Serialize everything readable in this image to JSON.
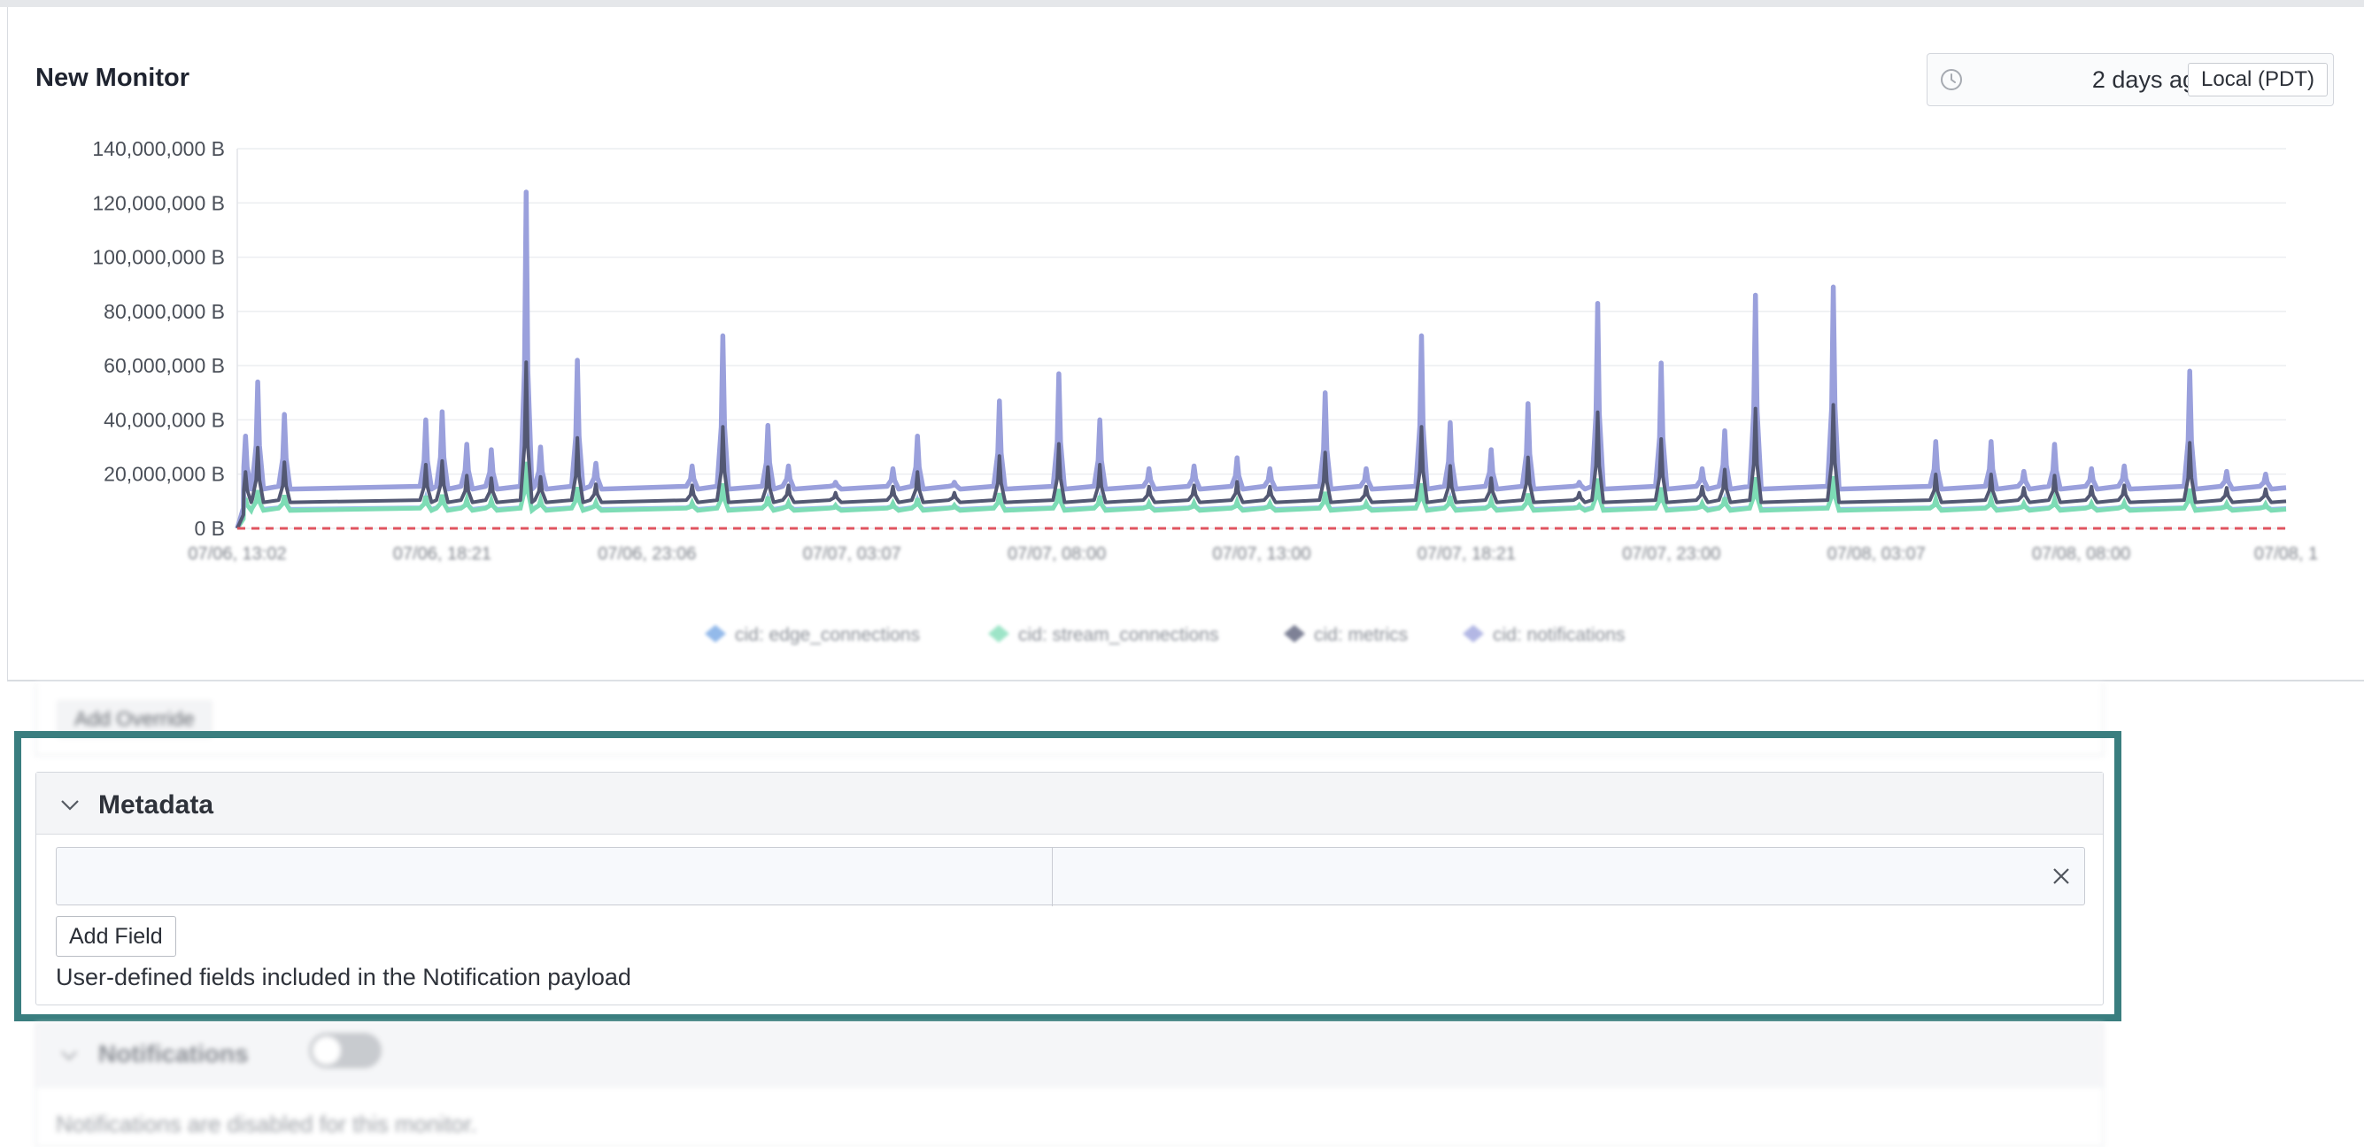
{
  "monitor": {
    "title": "New Monitor",
    "time_range": "2 days ago",
    "timezone": "Local (PDT)"
  },
  "chart_data": {
    "type": "line",
    "yticks": [
      "140,000,000 B",
      "120,000,000 B",
      "100,000,000 B",
      "80,000,000 B",
      "60,000,000 B",
      "40,000,000 B",
      "20,000,000 B",
      "0 B"
    ],
    "ylim": [
      0,
      140000000
    ],
    "xlim": [
      0,
      100
    ],
    "xticks": [
      "07/06, 13:02",
      "07/06, 18:21",
      "07/06, 23:06",
      "07/07, 03:07",
      "07/07, 08:00",
      "07/07, 13:00",
      "07/07, 18:21",
      "07/07, 23:00",
      "07/08, 03:07",
      "07/08, 08:00",
      "07/08, 1"
    ],
    "legend": [
      "cid: edge_connections",
      "cid: stream_connections",
      "cid: metrics",
      "cid: notifications"
    ],
    "legend_position": "bottom",
    "grid": true,
    "threshold": 0,
    "colors": {
      "edge_connections": "#6fa3e3",
      "stream_connections": "#7ddcb5",
      "metrics": "#535873",
      "notifications": "#9aa0dc",
      "threshold": "#e05560"
    },
    "baselines": {
      "edge_connections": 7500000,
      "stream_connections": 7000000,
      "metrics": 10000000,
      "notifications": 15000000
    },
    "series_notifications_spikes": [
      [
        0.4,
        34000000
      ],
      [
        1.0,
        54000000
      ],
      [
        2.3,
        42000000
      ],
      [
        9.2,
        40000000
      ],
      [
        10.0,
        43000000
      ],
      [
        11.2,
        31000000
      ],
      [
        12.4,
        29000000
      ],
      [
        14.1,
        124000000
      ],
      [
        14.8,
        30000000
      ],
      [
        16.6,
        62000000
      ],
      [
        17.5,
        24000000
      ],
      [
        22.2,
        23000000
      ],
      [
        23.7,
        71000000
      ],
      [
        25.9,
        38000000
      ],
      [
        26.9,
        23000000
      ],
      [
        29.2,
        17000000
      ],
      [
        32.0,
        22000000
      ],
      [
        33.2,
        34000000
      ],
      [
        35.0,
        17000000
      ],
      [
        37.2,
        47000000
      ],
      [
        40.1,
        57000000
      ],
      [
        42.1,
        40000000
      ],
      [
        44.5,
        22000000
      ],
      [
        46.7,
        23000000
      ],
      [
        48.8,
        26000000
      ],
      [
        50.4,
        22000000
      ],
      [
        53.1,
        50000000
      ],
      [
        55.1,
        22000000
      ],
      [
        57.8,
        71000000
      ],
      [
        59.2,
        39000000
      ],
      [
        61.2,
        29000000
      ],
      [
        63.0,
        46000000
      ],
      [
        65.5,
        17000000
      ],
      [
        66.4,
        83000000
      ],
      [
        69.5,
        61000000
      ],
      [
        71.5,
        22000000
      ],
      [
        72.6,
        36000000
      ],
      [
        74.1,
        86000000
      ],
      [
        77.9,
        89000000
      ],
      [
        82.9,
        32000000
      ],
      [
        85.6,
        32000000
      ],
      [
        87.2,
        21000000
      ],
      [
        88.7,
        31000000
      ],
      [
        90.5,
        22000000
      ],
      [
        92.1,
        23000000
      ],
      [
        95.3,
        58000000
      ],
      [
        97.1,
        21000000
      ],
      [
        99.0,
        20000000
      ]
    ]
  },
  "above": {
    "button": "Add Override"
  },
  "metadata": {
    "title": "Metadata",
    "key_value": "",
    "value_value": "",
    "add_field": "Add Field",
    "help": "User-defined fields included in the Notification payload"
  },
  "notifications": {
    "title": "Notifications",
    "description": "Notifications are disabled for this monitor."
  }
}
